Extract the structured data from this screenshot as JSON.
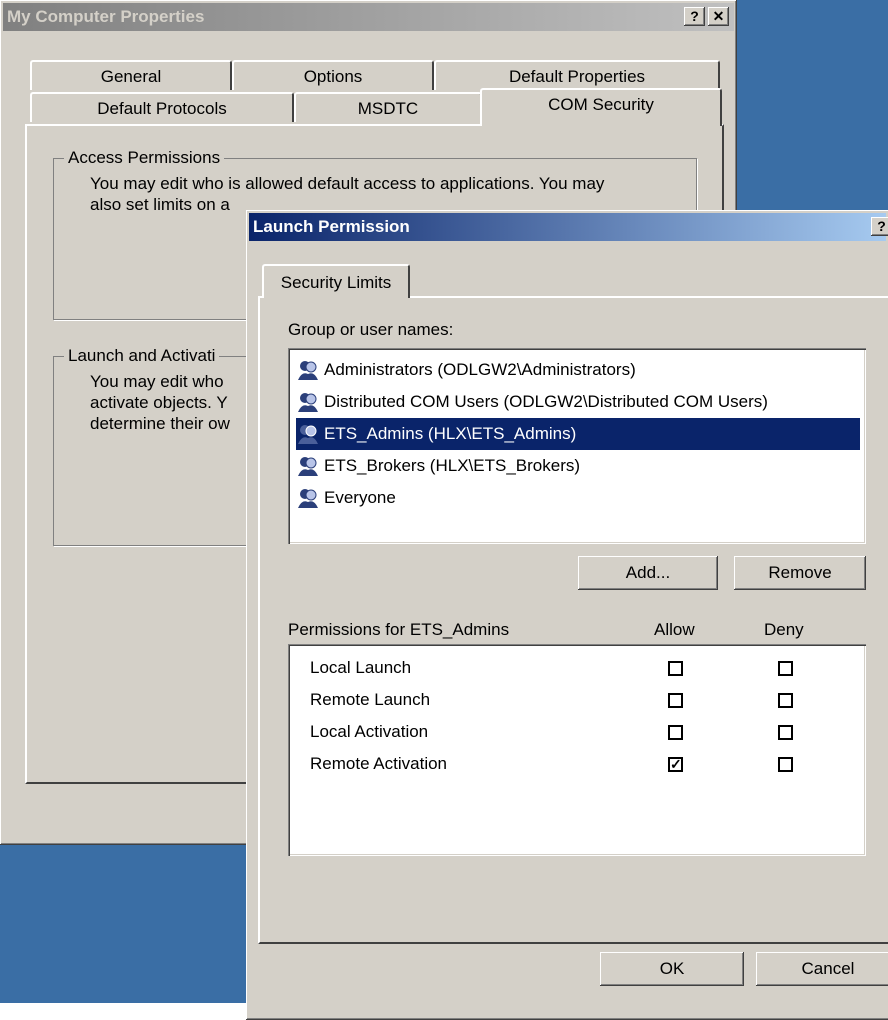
{
  "back_window": {
    "title": "My Computer Properties",
    "help_btn": "?",
    "close_btn": "✕",
    "tabs_row1": [
      "General",
      "Options",
      "Default Properties"
    ],
    "tabs_row2": [
      "Default Protocols",
      "MSDTC",
      "COM Security"
    ],
    "access_group": {
      "legend": "Access Permissions",
      "line1": "You may edit who is allowed default access to applications. You may",
      "line2": "also set limits on a"
    },
    "launch_group": {
      "legend": "Launch and Activati",
      "line1": "You may edit who",
      "line2": "activate objects. Y",
      "line3": "determine their ow"
    }
  },
  "dialog": {
    "title": "Launch Permission",
    "help_btn": "?",
    "close_btn": "✕",
    "tab": "Security Limits",
    "group_label": "Group or user names:",
    "users": [
      {
        "name": "Administrators (ODLGW2\\Administrators)",
        "selected": false
      },
      {
        "name": "Distributed COM Users (ODLGW2\\Distributed COM Users)",
        "selected": false
      },
      {
        "name": "ETS_Admins (HLX\\ETS_Admins)",
        "selected": true
      },
      {
        "name": "ETS_Brokers (HLX\\ETS_Brokers)",
        "selected": false
      },
      {
        "name": "Everyone",
        "selected": false
      }
    ],
    "add_button": "Add...",
    "remove_button": "Remove",
    "permissions_label": "Permissions for ETS_Admins",
    "allow_header": "Allow",
    "deny_header": "Deny",
    "permissions": [
      {
        "name": "Local Launch",
        "allow": false,
        "deny": false
      },
      {
        "name": "Remote Launch",
        "allow": false,
        "deny": false
      },
      {
        "name": "Local Activation",
        "allow": false,
        "deny": false
      },
      {
        "name": "Remote Activation",
        "allow": true,
        "deny": false
      }
    ],
    "ok_button": "OK",
    "cancel_button": "Cancel"
  },
  "colors": {
    "desktop": "#3a6ea5",
    "selection": "#0a246a",
    "face": "#d4d0c8"
  }
}
